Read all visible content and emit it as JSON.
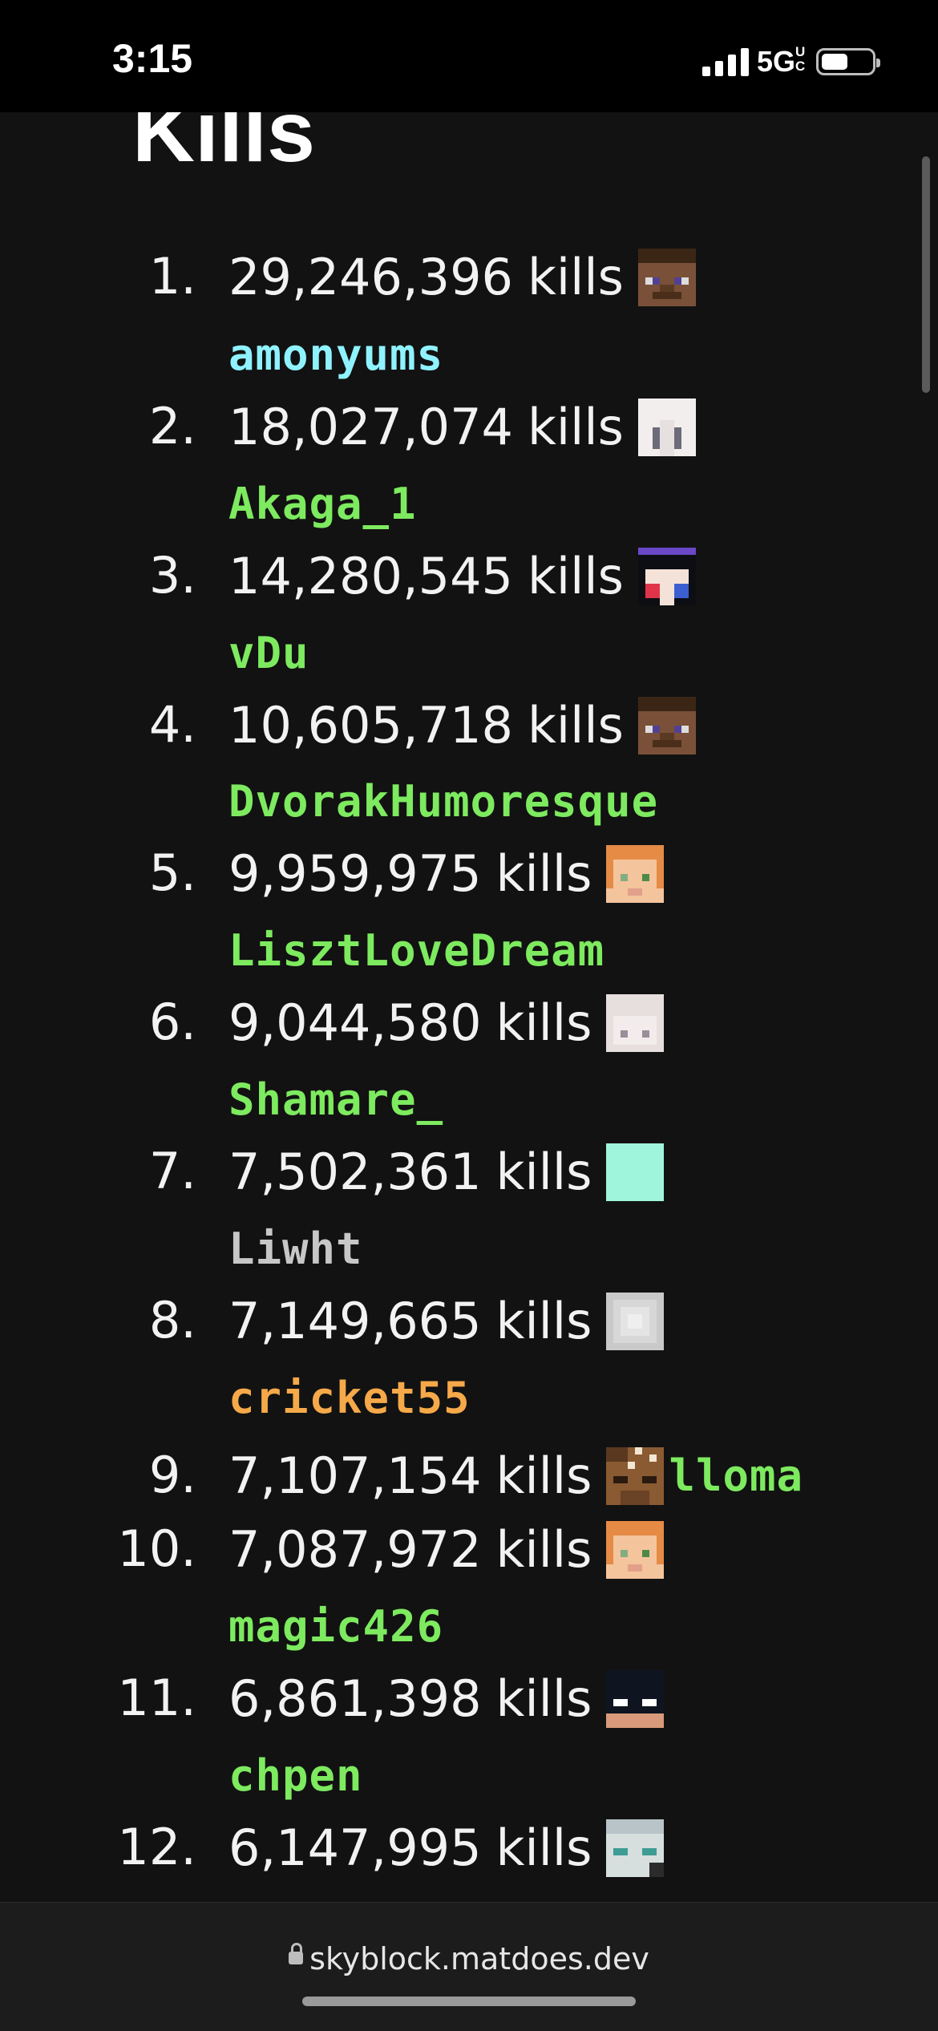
{
  "status_bar": {
    "time": "3:15",
    "network": "5G",
    "network_sup": "UC"
  },
  "heading": "Kills",
  "url": "skyblock.matdoes.dev",
  "colors": {
    "green": "#7dea5f",
    "aqua": "#8ff2ff",
    "gray": "#c7c7c7",
    "gold": "#f5a949"
  },
  "leaderboard": [
    {
      "rank": "1.",
      "value": "29,246,396",
      "unit": "kills",
      "avatar": "steve-icon",
      "name": "amonyums",
      "color": "#8ff2ff"
    },
    {
      "rank": "2.",
      "value": "18,027,074",
      "unit": "kills",
      "avatar": "white-hair-icon",
      "name": "Akaga_1",
      "color": "#7dea5f"
    },
    {
      "rank": "3.",
      "value": "14,280,545",
      "unit": "kills",
      "avatar": "dark-hair-icon",
      "name": "vDu",
      "color": "#7dea5f"
    },
    {
      "rank": "4.",
      "value": "10,605,718",
      "unit": "kills",
      "avatar": "steve-icon",
      "name": "DvorakHumoresque",
      "color": "#7dea5f"
    },
    {
      "rank": "5.",
      "value": "9,959,975",
      "unit": "kills",
      "avatar": "alex-icon",
      "name": "LisztLoveDream",
      "color": "#7dea5f"
    },
    {
      "rank": "6.",
      "value": "9,044,580",
      "unit": "kills",
      "avatar": "pale-hair-icon",
      "name": "Shamare_",
      "color": "#7dea5f"
    },
    {
      "rank": "7.",
      "value": "7,502,361",
      "unit": "kills",
      "avatar": "aqua-square-icon",
      "name": "Liwht",
      "color": "#c7c7c7"
    },
    {
      "rank": "8.",
      "value": "7,149,665",
      "unit": "kills",
      "avatar": "gray-blur-icon",
      "name": "cricket55",
      "color": "#f5a949"
    },
    {
      "rank": "9.",
      "value": "7,107,154",
      "unit": "kills",
      "avatar": "brown-spotted-icon",
      "name": "lloma",
      "color": "#7dea5f",
      "inline": true
    },
    {
      "rank": "10.",
      "value": "7,087,972",
      "unit": "kills",
      "avatar": "alex-icon",
      "name": "magic426",
      "color": "#7dea5f"
    },
    {
      "rank": "11.",
      "value": "6,861,398",
      "unit": "kills",
      "avatar": "masked-icon",
      "name": "chpen",
      "color": "#7dea5f"
    },
    {
      "rank": "12.",
      "value": "6,147,995",
      "unit": "kills",
      "avatar": "teal-hair-icon",
      "name": "",
      "color": "#7dea5f"
    }
  ]
}
